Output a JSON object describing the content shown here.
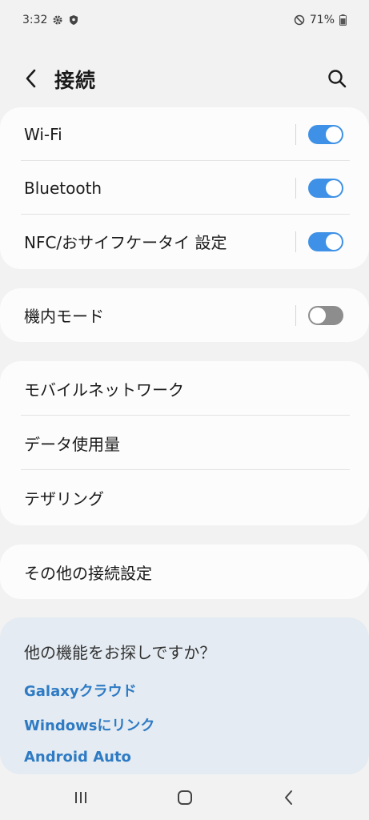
{
  "status": {
    "time": "3:32",
    "left_icons": [
      "gear-icon",
      "shield-icon"
    ],
    "right_icons": [
      "do-not-disturb-icon",
      "battery-icon"
    ],
    "battery": "71%"
  },
  "header": {
    "title": "接続",
    "back_icon": "chevron-left-icon",
    "search_icon": "search-icon"
  },
  "groups": {
    "toggles": [
      {
        "label": "Wi-Fi",
        "on": true
      },
      {
        "label": "Bluetooth",
        "on": true
      },
      {
        "label": "NFC/おサイフケータイ 設定",
        "on": true
      }
    ],
    "airplane": {
      "label": "機内モード",
      "on": false
    },
    "network": [
      "モバイルネットワーク",
      "データ使用量",
      "テザリング"
    ],
    "other": "その他の接続設定"
  },
  "suggest": {
    "title": "他の機能をお探しですか？",
    "links": [
      "Galaxyクラウド",
      "Windowsにリンク",
      "Android Auto"
    ]
  },
  "navbar": {
    "icons": [
      "recent-apps-icon",
      "home-icon",
      "back-icon"
    ]
  },
  "colors": {
    "toggle_on": "#3e91e6",
    "toggle_off": "#8d8d8d",
    "link": "#2e7bc4",
    "suggest_bg": "#e4ebf2"
  }
}
